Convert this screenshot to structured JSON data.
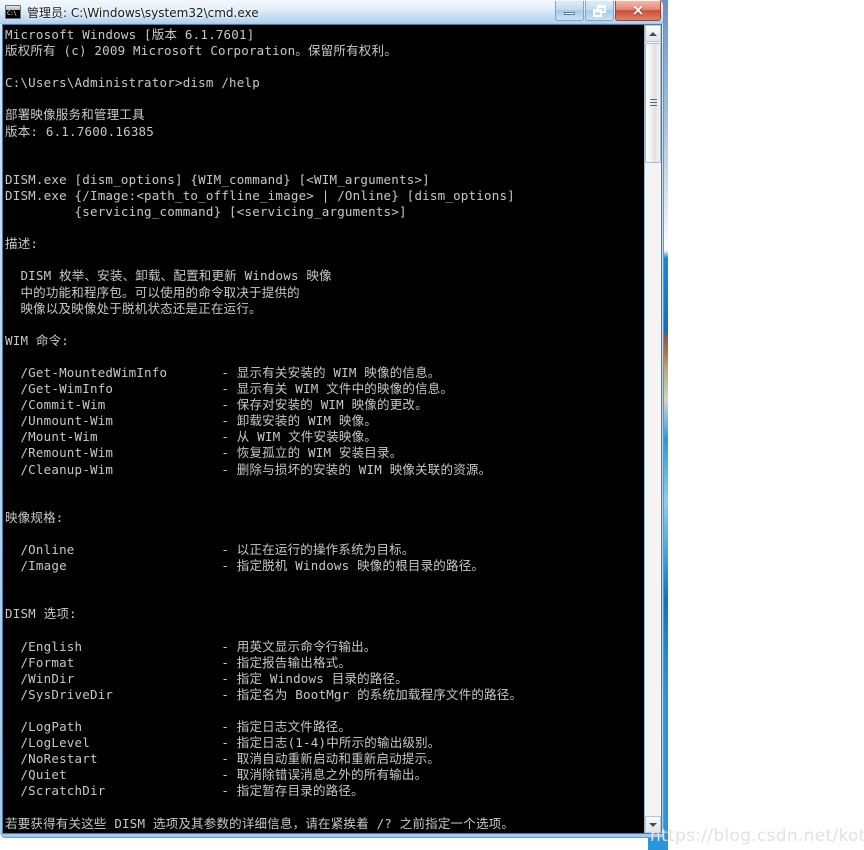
{
  "window": {
    "title": "管理员: C:\\Windows\\system32\\cmd.exe",
    "icon_name": "cmd-console-icon",
    "icon_glyph": "C:\\",
    "minimize_label": "最小化",
    "restore_label": "还原",
    "close_label": "×"
  },
  "scrollbar": {
    "up_label": "▲",
    "down_label": "▼"
  },
  "console": {
    "lines": [
      "Microsoft Windows [版本 6.1.7601]",
      "版权所有 (c) 2009 Microsoft Corporation。保留所有权利。",
      "",
      "C:\\Users\\Administrator>dism /help",
      "",
      "部署映像服务和管理工具",
      "版本: 6.1.7600.16385",
      "",
      "",
      "DISM.exe [dism_options] {WIM_command} [<WIM_arguments>]",
      "DISM.exe {/Image:<path_to_offline_image> | /Online} [dism_options]",
      "         {servicing_command} [<servicing_arguments>]",
      "",
      "描述:",
      "",
      "  DISM 枚举、安装、卸载、配置和更新 Windows 映像",
      "  中的功能和程序包。可以使用的命令取决于提供的",
      "  映像以及映像处于脱机状态还是正在运行。",
      "",
      "WIM 命令:",
      "",
      "  /Get-MountedWimInfo       - 显示有关安装的 WIM 映像的信息。",
      "  /Get-WimInfo              - 显示有关 WIM 文件中的映像的信息。",
      "  /Commit-Wim               - 保存对安装的 WIM 映像的更改。",
      "  /Unmount-Wim              - 卸载安装的 WIM 映像。",
      "  /Mount-Wim                - 从 WIM 文件安装映像。",
      "  /Remount-Wim              - 恢复孤立的 WIM 安装目录。",
      "  /Cleanup-Wim              - 删除与损坏的安装的 WIM 映像关联的资源。",
      "",
      "",
      "映像规格:",
      "",
      "  /Online                   - 以正在运行的操作系统为目标。",
      "  /Image                    - 指定脱机 Windows 映像的根目录的路径。",
      "",
      "",
      "DISM 选项:",
      "",
      "  /English                  - 用英文显示命令行输出。",
      "  /Format                   - 指定报告输出格式。",
      "  /WinDir                   - 指定 Windows 目录的路径。",
      "  /SysDriveDir              - 指定名为 BootMgr 的系统加载程序文件的路径。",
      "",
      "  /LogPath                  - 指定日志文件路径。",
      "  /LogLevel                 - 指定日志(1-4)中所示的输出级别。",
      "  /NoRestart                - 取消自动重新启动和重新启动提示。",
      "  /Quiet                    - 取消除错误消息之外的所有输出。",
      "  /ScratchDir               - 指定暂存目录的路径。",
      "",
      "若要获得有关这些 DISM 选项及其参数的详细信息，请在紧挨着 /? 之前指定一个选项。"
    ]
  },
  "watermark": {
    "text": "https://blog.csdn.net/kotori_poi"
  }
}
